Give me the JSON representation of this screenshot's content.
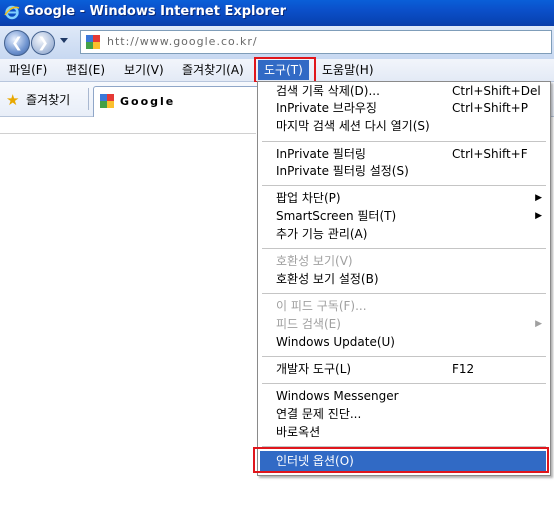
{
  "window": {
    "title": "Google - Windows Internet Explorer"
  },
  "address": {
    "url": "htt://www.google.co.kr/"
  },
  "menu_bar": [
    {
      "label": "파일(F)"
    },
    {
      "label": "편집(E)"
    },
    {
      "label": "보기(V)"
    },
    {
      "label": "즐겨찾기(A)"
    },
    {
      "label": "도구(T)"
    },
    {
      "label": "도움말(H)"
    }
  ],
  "favorites": {
    "label": "즐겨찾기"
  },
  "tab": {
    "title": "Google"
  },
  "tools_menu": {
    "items": [
      {
        "label": "검색 기록 삭제(D)...",
        "shortcut": "Ctrl+Shift+Del"
      },
      {
        "label": "InPrivate 브라우징",
        "shortcut": "Ctrl+Shift+P"
      },
      {
        "label": "마지막 검색 세션 다시 열기(S)",
        "shortcut": ""
      },
      {
        "label": "InPrivate 필터링",
        "shortcut": "Ctrl+Shift+F"
      },
      {
        "label": "InPrivate 필터링 설정(S)",
        "shortcut": ""
      },
      {
        "label": "팝업 차단(P)",
        "shortcut": "",
        "submenu": true
      },
      {
        "label": "SmartScreen 필터(T)",
        "shortcut": "",
        "submenu": true
      },
      {
        "label": "추가 기능 관리(A)",
        "shortcut": ""
      },
      {
        "label": "호환성 보기(V)",
        "shortcut": "",
        "disabled": true
      },
      {
        "label": "호환성 보기 설정(B)",
        "shortcut": ""
      },
      {
        "label": "이 피드 구독(F)...",
        "shortcut": "",
        "disabled": true
      },
      {
        "label": "피드 검색(E)",
        "shortcut": "",
        "disabled": true,
        "submenu": true
      },
      {
        "label": "Windows Update(U)",
        "shortcut": ""
      },
      {
        "label": "개발자 도구(L)",
        "shortcut": "F12"
      },
      {
        "label": "Windows Messenger",
        "shortcut": ""
      },
      {
        "label": "연결 문제 진단...",
        "shortcut": ""
      },
      {
        "label": "바로옥션",
        "shortcut": ""
      },
      {
        "label": "인터넷 옵션(O)",
        "shortcut": "",
        "selected": true
      }
    ]
  },
  "colors": {
    "highlight_border": "#e0161c",
    "selection": "#316ac5",
    "titlebar": "#0b4fc9"
  }
}
